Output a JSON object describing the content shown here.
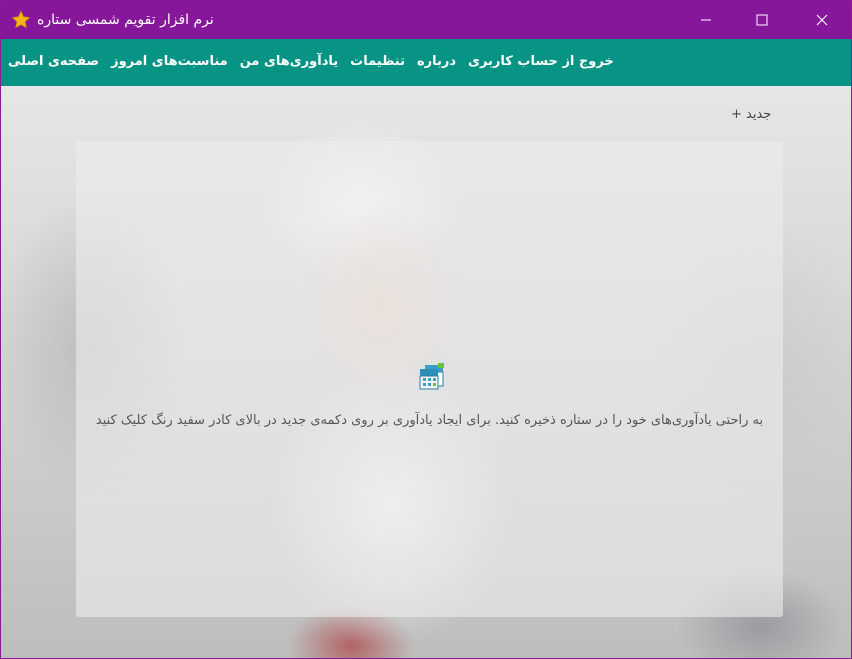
{
  "window": {
    "title": "نرم افزار تقویم شمسی ستاره",
    "icons": {
      "app": "star-icon",
      "minimize": "minimize-icon",
      "maximize": "maximize-icon",
      "close": "close-icon"
    },
    "colors": {
      "titlebar": "#87179a",
      "navbar": "#089485",
      "accent_star": "#f5b21b"
    }
  },
  "nav": {
    "items": [
      {
        "label": "صفحه‌ی اصلی"
      },
      {
        "label": "مناسبت‌های امروز"
      },
      {
        "label": "یادآوری‌های من"
      },
      {
        "label": "تنظیمات"
      },
      {
        "label": "درباره"
      },
      {
        "label": "خروج از حساب کاربری"
      }
    ]
  },
  "main": {
    "new_button_label": "جدید +",
    "empty_state": {
      "icon": "calendar-icon",
      "message": "به راحتی یادآوری‌های خود را در ستاره ذخیره کنید. برای ایجاد یادآوری بر روی دکمه‌ی جدید در بالای کادر سفید رنگ کلیک کنید"
    }
  }
}
